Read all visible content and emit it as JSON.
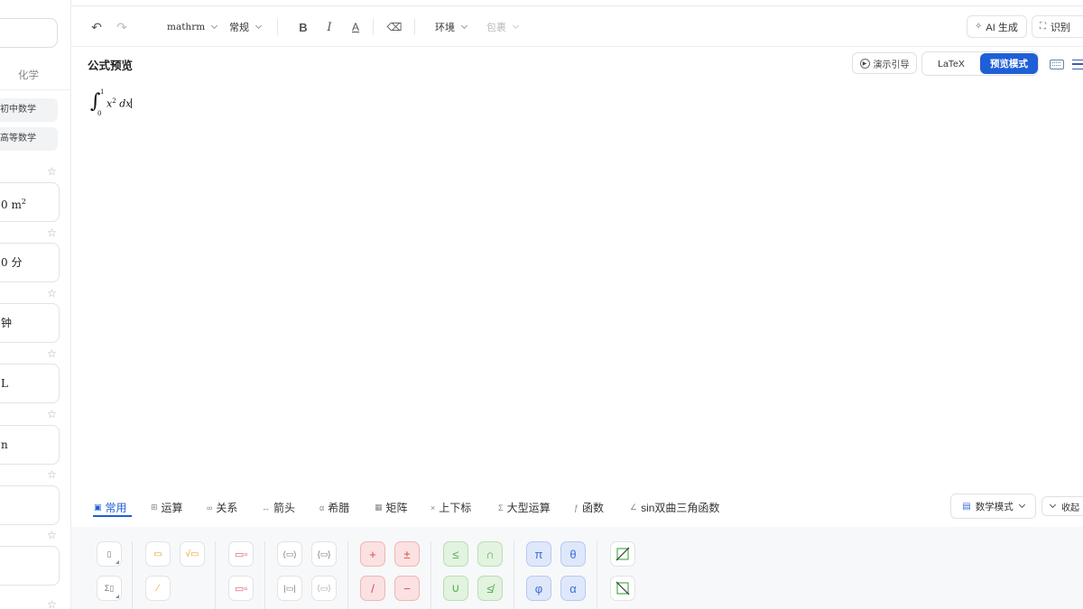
{
  "sidebar": {
    "tab_label": "化学",
    "chips": [
      "初中数学",
      "高等数学"
    ],
    "cards": [
      "0 m",
      "0 分",
      "钟",
      "L",
      "n",
      "",
      ""
    ],
    "card_sup_0": "2"
  },
  "toolbar": {
    "font_select": "mathrm",
    "style_select": "常规",
    "env_select": "环境",
    "wrap_select": "包裹",
    "ai_label": "AI 生成",
    "recognize_label": "识别"
  },
  "preview": {
    "title": "公式预览",
    "demo_label": "演示引导",
    "latex_label": "LaTeX",
    "preview_mode_label": "预览模式"
  },
  "formula": {
    "upper": "1",
    "lower": "0",
    "base": "x",
    "exp": "2",
    "tail": "dx"
  },
  "panel": {
    "tabs": [
      {
        "label": "常用",
        "icon": "▣"
      },
      {
        "label": "运算",
        "icon": "⊞"
      },
      {
        "label": "关系",
        "icon": "∞"
      },
      {
        "label": "箭头",
        "icon": "↔"
      },
      {
        "label": "希腊",
        "icon": "α"
      },
      {
        "label": "矩阵",
        "icon": "▦"
      },
      {
        "label": "上下标",
        "icon": "×"
      },
      {
        "label": "大型运算",
        "icon": "Σ"
      },
      {
        "label": "函数",
        "icon": "ƒ"
      },
      {
        "label": "sin双曲三角函数",
        "icon": "∠"
      }
    ],
    "mode_label": "数学模式",
    "collapse_label": "收起",
    "symbols": {
      "plus": "+",
      "pm": "±",
      "div": "/",
      "minus": "−",
      "leq": "≤",
      "cap": "∩",
      "cup": "∪",
      "nleq": "≰",
      "pi": "π",
      "theta": "θ",
      "phi": "φ",
      "alpha": "α"
    }
  },
  "colors": {
    "accent": "#1f5fd6",
    "red": "#d94a4a",
    "green": "#4caf50",
    "blue": "#3a6fd8"
  }
}
